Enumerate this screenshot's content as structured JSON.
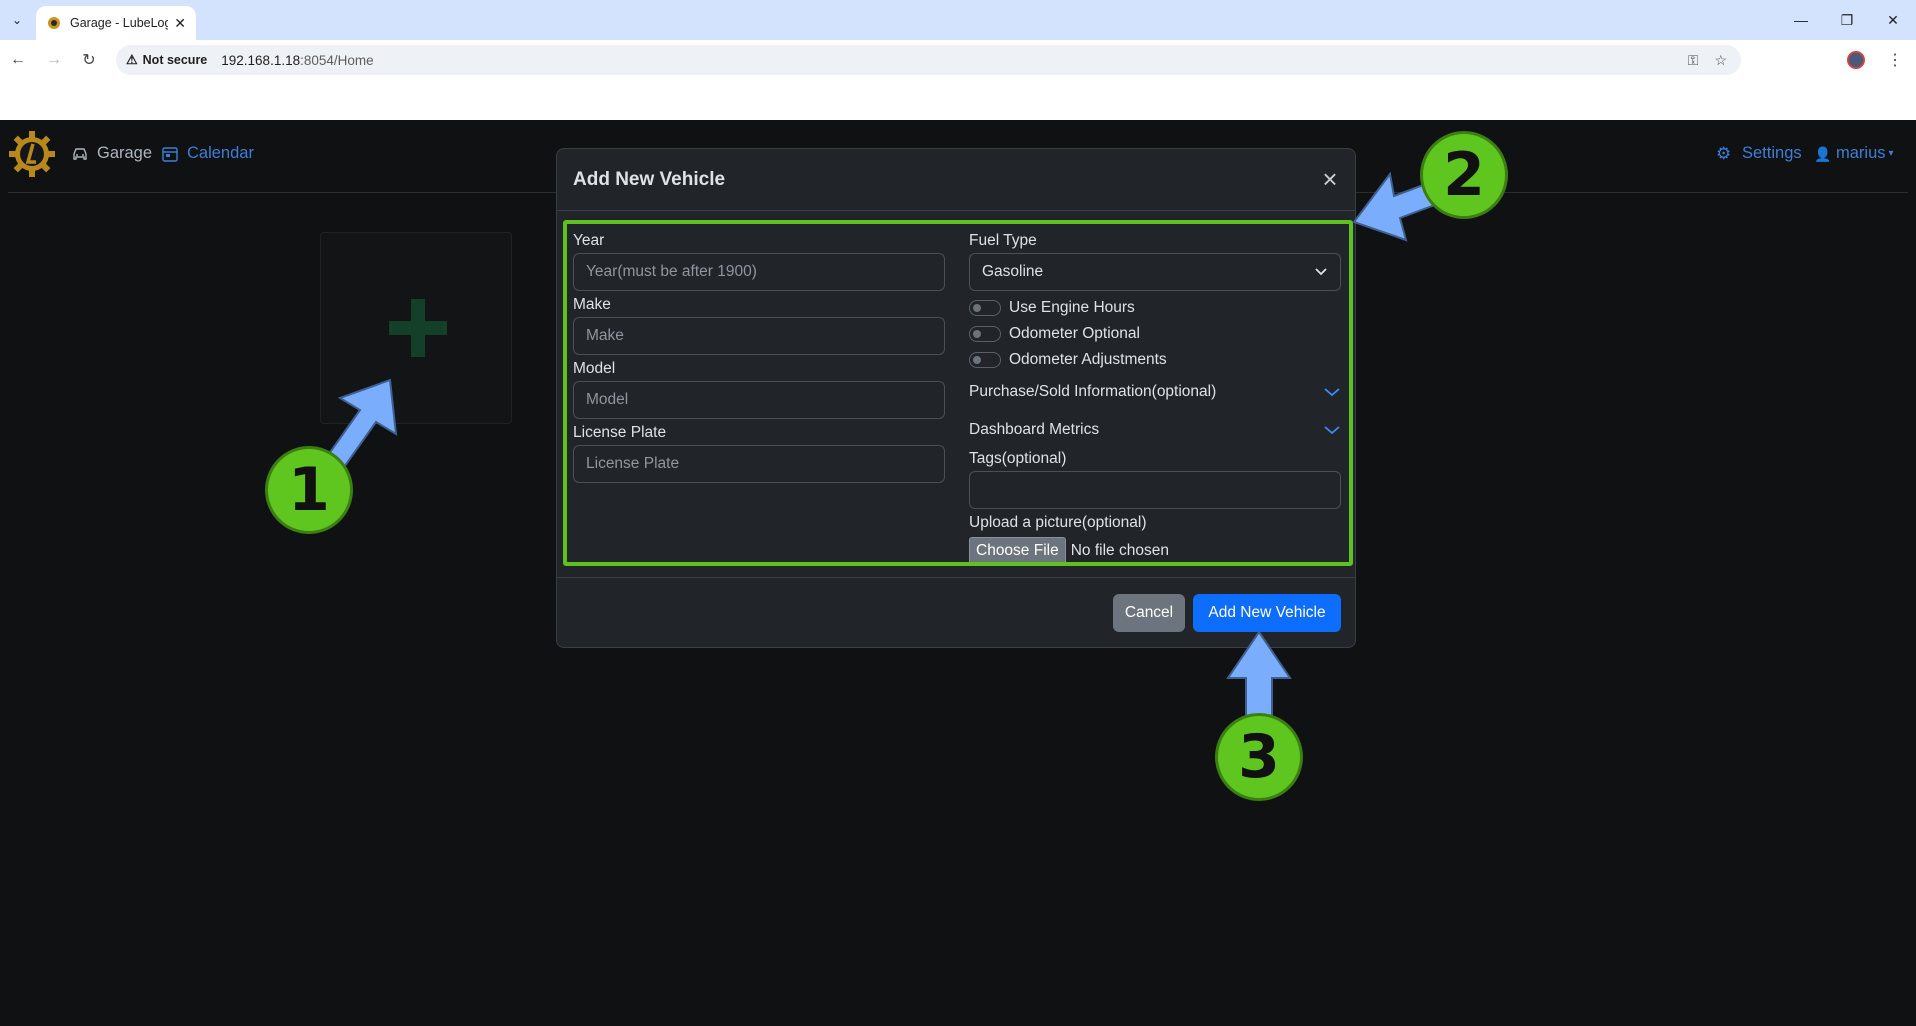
{
  "browser": {
    "tab_title": "Garage - LubeLog",
    "address": {
      "security": "Not secure",
      "host": "192.168.1.18",
      "path": ":8054/Home"
    },
    "icons": [
      "tab-list-icon",
      "close-tab-icon",
      "minimize-icon",
      "restore-icon",
      "close-window-icon",
      "back-icon",
      "forward-icon",
      "reload-icon",
      "warning-icon",
      "password-key-icon",
      "bookmark-star-icon",
      "profile-avatar",
      "menu-kebab-icon"
    ]
  },
  "app": {
    "nav": {
      "garage": "Garage",
      "calendar": "Calendar",
      "settings": "Settings",
      "user": "marius"
    }
  },
  "modal": {
    "title": "Add New Vehicle",
    "year_label": "Year",
    "year_placeholder": "Year(must be after 1900)",
    "make_label": "Make",
    "make_placeholder": "Make",
    "model_label": "Model",
    "model_placeholder": "Model",
    "plate_label": "License Plate",
    "plate_placeholder": "License Plate",
    "fuel_label": "Fuel Type",
    "fuel_value": "Gasoline",
    "switch_engine_hours": "Use Engine Hours",
    "switch_odometer_optional": "Odometer Optional",
    "switch_odometer_adjustments": "Odometer Adjustments",
    "purchase_info": "Purchase/Sold Information(optional)",
    "dashboard_metrics": "Dashboard Metrics",
    "tags_label": "Tags(optional)",
    "upload_label": "Upload a picture(optional)",
    "choose_file": "Choose File",
    "no_file": "No file chosen",
    "cancel": "Cancel",
    "submit": "Add New Vehicle"
  },
  "annotations": {
    "badge1": "1",
    "badge2": "2",
    "badge3": "3",
    "badge_color": "#5fc61f",
    "arrow_color": "#7aaefc",
    "box_color": "#5ec11f"
  }
}
